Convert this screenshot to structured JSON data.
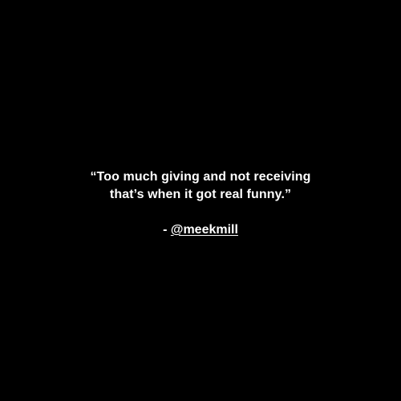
{
  "quote": {
    "line1": "“Too much giving and not receiving",
    "line2": "that’s when it got real funny.”"
  },
  "attribution": {
    "prefix": "- ",
    "handle": "@meekmill"
  },
  "colors": {
    "background": "#000000",
    "text": "#ffffff"
  }
}
